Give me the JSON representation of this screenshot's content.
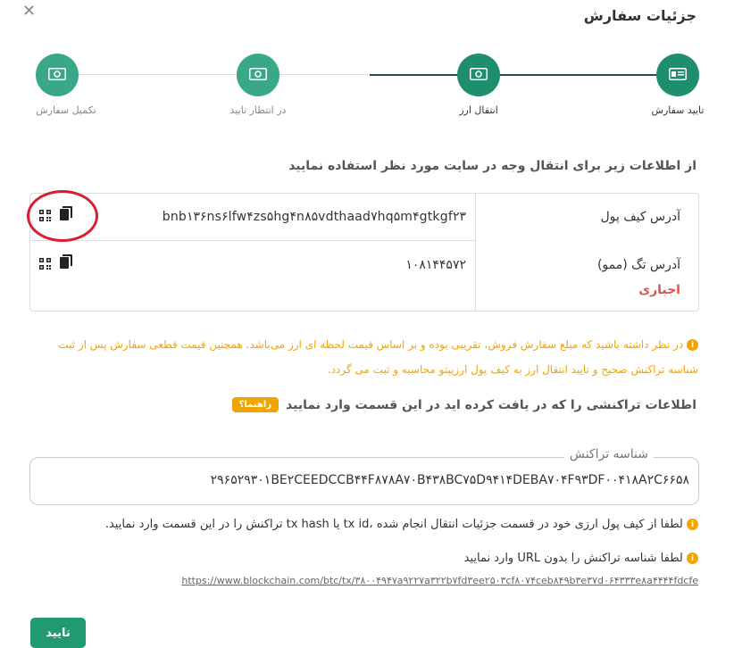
{
  "modal": {
    "title": "جزئیات سفارش",
    "close_glyph": "✕"
  },
  "steps": [
    {
      "label": "تایید سفارش",
      "icon": "id-card-icon",
      "state": "active"
    },
    {
      "label": "انتقال ارز",
      "icon": "money-icon",
      "state": "active"
    },
    {
      "label": "در انتظار تایید",
      "icon": "money-icon",
      "state": "pending"
    },
    {
      "label": "تکمیل سفارش",
      "icon": "money-icon",
      "state": "pending"
    }
  ],
  "instruction": "از اطلاعات زیر برای انتقال وجه در سایت مورد نظر استفاده نمایید",
  "wallet": {
    "address_label": "آدرس کیف پول",
    "address_value": "bnb۱۳۶ns۶lfw۴zs۵hg۴n۸۵vdthaad۷hq۵m۴gtkgf۲۳",
    "tag_label": "آدرس تگ (ممو)",
    "tag_value": "۱۰۸۱۴۴۵۷۲",
    "required_label": "اجباری"
  },
  "notice": "در نظر داشته باشید که مبلغ سفارش فروش، تقریبی بوده و بر اساس قیمت لحظه ای ارز می‌باشد. همچنین قیمت قطعی سفارش پس از ثبت شناسه تراکنش صحیح و تایید انتقال ارز به کیف پول ارزیپتو محاسبه و ثبت می گردد.",
  "tx_section": {
    "heading": "اطلاعات تراکنشی را که در یافت کرده اید در این قسمت وارد نمایید",
    "guide_badge": "راهنما؟",
    "field_legend": "شناسه تراکنش",
    "field_value": "۲۹۶۵۲۹۳۰۱BE۲CEEDCCB۴۴F۸۷۸A۷۰B۴۳۸BC۷۵D۹۴۱۴DEBA۷۰۴F۹۳DF۰۰۴۱۸A۲C۶۶۵۸"
  },
  "help": {
    "line1": "لطفا از کیف پول ارزی خود در قسمت جزئیات انتقال انجام شده ،tx id یا tx hash تراکنش را در این قسمت وارد نمایید.",
    "line2": "لطفا شناسه تراکنش را بدون URL وارد نمایید",
    "example_url": "https://www.blockchain.com/btc/tx/۳۸۰۰۴۹۴۷a۹۲۲۷a۳۲۲b۷fd۳ee۲۵۰۳cf۸۰۷۴ceb۸۴۹b۳e۳۷d۰۶۴۳۳۳e۸a۴۴۴۴fdcfe"
  },
  "submit_label": "تایید",
  "colors": {
    "primary": "#1f9a72",
    "step_active": "#1f8e6e",
    "warning": "#f0a500",
    "danger": "#d9534f",
    "highlight_circle": "#d42030"
  }
}
